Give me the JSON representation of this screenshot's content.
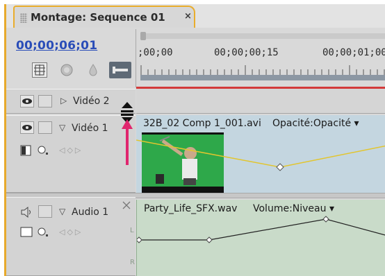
{
  "window": {
    "tab_title": "Montage: Sequence 01",
    "close_glyph": "×"
  },
  "header": {
    "timecode": "00;00;06;01",
    "ruler_labels": [
      ";00;00",
      "00;00;00;15",
      "00;00;01;00"
    ]
  },
  "tracks": {
    "video2": {
      "name": "Vidéo 2"
    },
    "video1": {
      "name": "Vidéo 1",
      "clip_filename": "32B_02 Comp 1_001.avi",
      "clip_effect": "Opacité:Opacité ▾"
    },
    "audio1": {
      "name": "Audio 1",
      "clip_filename": "Party_Life_SFX.wav",
      "clip_effect": "Volume:Niveau ▾",
      "channel_left": "L",
      "channel_right": "R"
    }
  },
  "colors": {
    "accent_tab": "#e9ad2c",
    "timecode": "#2a4db8",
    "video_lane": "#c4d6e0",
    "audio_lane": "#c9dbc9",
    "opacity_line": "#e2c52e",
    "playhead_line": "#d33a3a",
    "annotation_arrow": "#e0266e"
  },
  "icons": {
    "snap": "snap-icon",
    "marker": "marker-icon",
    "keyframe": "keyframe-icon",
    "wrench": "wrench-icon",
    "eye": "eye-icon",
    "speaker": "speaker-icon",
    "resize_cursor": "resize-cursor-icon"
  }
}
